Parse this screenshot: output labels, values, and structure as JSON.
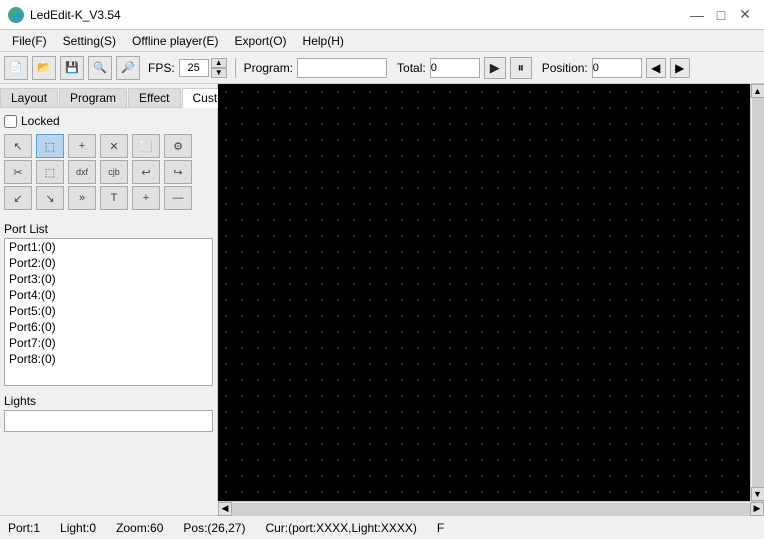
{
  "window": {
    "title": "LedEdit-K_V3.54",
    "icon": "led-icon"
  },
  "title_buttons": {
    "minimize": "—",
    "maximize": "□",
    "close": "✕"
  },
  "menu": {
    "items": [
      {
        "label": "File(F)"
      },
      {
        "label": "Setting(S)"
      },
      {
        "label": "Offline player(E)"
      },
      {
        "label": "Export(O)"
      },
      {
        "label": "Help(H)"
      }
    ]
  },
  "toolbar": {
    "fps_label": "FPS:",
    "fps_value": "25",
    "program_label": "Program:",
    "program_value": "",
    "total_label": "Total:",
    "total_value": "0",
    "play_icon": "▶",
    "pause_icon": "⏸",
    "position_label": "Position:",
    "position_value": "0",
    "nav_left": "◀",
    "nav_right": "▶"
  },
  "tabs": {
    "items": [
      {
        "label": "Layout",
        "active": false
      },
      {
        "label": "Program",
        "active": false
      },
      {
        "label": "Effect",
        "active": false
      },
      {
        "label": "Custom",
        "active": true
      }
    ],
    "arrow_left": "◀",
    "arrow_right": "▶"
  },
  "tool_panel": {
    "locked_label": "Locked",
    "tools": [
      {
        "icon": "↖",
        "name": "select"
      },
      {
        "icon": "⬚",
        "name": "matrix",
        "active": true
      },
      {
        "icon": "+",
        "name": "add"
      },
      {
        "icon": "✕",
        "name": "delete"
      },
      {
        "icon": "⬜",
        "name": "rect-select"
      },
      {
        "icon": "⚙",
        "name": "settings"
      },
      {
        "icon": "✂",
        "name": "cut"
      },
      {
        "icon": "⬚",
        "name": "matrix2"
      },
      {
        "icon": "dxf",
        "name": "dxf"
      },
      {
        "icon": "cjb",
        "name": "cjb"
      },
      {
        "icon": "↩",
        "name": "undo"
      },
      {
        "icon": "↪",
        "name": "redo"
      },
      {
        "icon": "↙",
        "name": "diag1"
      },
      {
        "icon": "↘",
        "name": "diag2"
      },
      {
        "icon": "»",
        "name": "forward"
      },
      {
        "icon": "T",
        "name": "text"
      },
      {
        "icon": "+",
        "name": "add2"
      },
      {
        "icon": "—",
        "name": "sub"
      }
    ]
  },
  "port_list": {
    "label": "Port List",
    "items": [
      {
        "label": "Port1:(0)"
      },
      {
        "label": "Port2:(0)"
      },
      {
        "label": "Port3:(0)"
      },
      {
        "label": "Port4:(0)"
      },
      {
        "label": "Port5:(0)"
      },
      {
        "label": "Port6:(0)"
      },
      {
        "label": "Port7:(0)"
      },
      {
        "label": "Port8:(0)"
      }
    ]
  },
  "lights": {
    "label": "Lights",
    "value": ""
  },
  "status_bar": {
    "port": "Port:1",
    "light": "Light:0",
    "zoom": "Zoom:60",
    "pos": "Pos:(26,27)",
    "cur": "Cur:(port:XXXX,Light:XXXX)",
    "flag": "F"
  }
}
